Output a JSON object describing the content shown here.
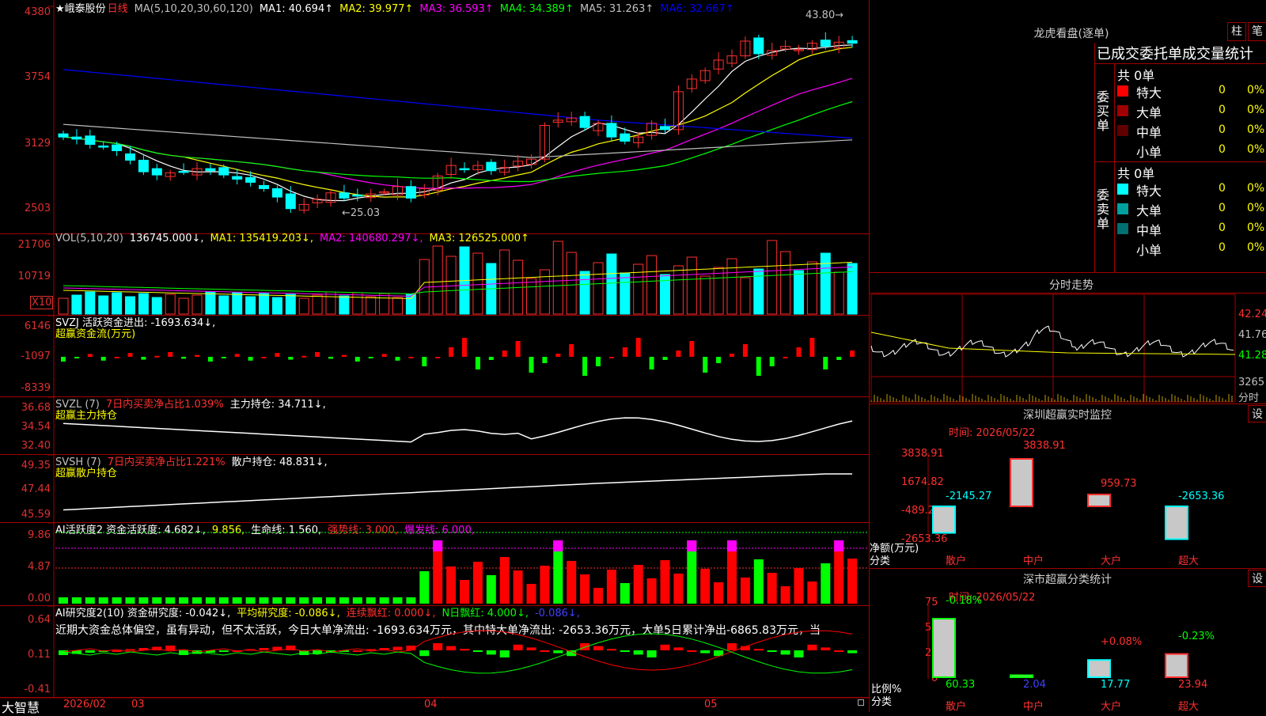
{
  "header": {
    "stock_name": "★峨泰股份",
    "period": "日线",
    "ma_params": "MA(5,10,20,30,60,120)",
    "ma_values": [
      {
        "label": "MA1: 40.694↑",
        "color": "#ffffff"
      },
      {
        "label": "MA2: 39.977↑",
        "color": "#ffff00"
      },
      {
        "label": "MA3: 36.593↑",
        "color": "#ff00ff"
      },
      {
        "label": "MA4: 34.389↑",
        "color": "#00ff00"
      },
      {
        "label": "MA5: 31.263↑",
        "color": "#c0c0c0"
      },
      {
        "label": "MA6: 32.667↑",
        "color": "#0000ff"
      }
    ],
    "high_mark": "43.80→",
    "low_mark": "←25.03"
  },
  "price_axis": [
    "4380",
    "3754",
    "3129",
    "2503"
  ],
  "volume": {
    "header": [
      {
        "label": "VOL(5,10,20)",
        "color": "#c0c0c0"
      },
      {
        "label": "136745.000↓,",
        "color": "#ffffff"
      },
      {
        "label": "MA1: 135419.203↓,",
        "color": "#ffff00"
      },
      {
        "label": "MA2: 140680.297↓,",
        "color": "#ff00ff"
      },
      {
        "label": "MA3: 126525.000↑",
        "color": "#ffff00"
      }
    ],
    "axis": [
      "21706",
      "10719"
    ],
    "unit": "X10"
  },
  "svzj": {
    "header": [
      {
        "label": "SVZJ  活跃资金进出: -1693.634↓,",
        "color": "#ffffff"
      }
    ],
    "subtitle": "超赢资金流(万元)",
    "axis": [
      "6146",
      "-1097",
      "-8339"
    ]
  },
  "svzl": {
    "header": [
      {
        "label": "SVZL (7)",
        "color": "#c0c0c0"
      },
      {
        "label": "7日内买卖净占比1.039%",
        "color": "#ff3030"
      },
      {
        "label": "主力持仓: 34.711↓,",
        "color": "#ffffff"
      }
    ],
    "subtitle": "超赢主力持仓",
    "axis": [
      "36.68",
      "34.54",
      "32.40"
    ]
  },
  "svsh": {
    "header": [
      {
        "label": "SVSH (7)",
        "color": "#c0c0c0"
      },
      {
        "label": "7日内买卖净占比1.221%",
        "color": "#ff3030"
      },
      {
        "label": "散户持仓: 48.831↓,",
        "color": "#ffffff"
      }
    ],
    "subtitle": "超赢散户持仓",
    "axis": [
      "49.35",
      "47.44",
      "45.59"
    ]
  },
  "ai_active": {
    "header": [
      {
        "label": "AI活跃度2 资金活跃度: 4.682↓,",
        "color": "#ffffff"
      },
      {
        "label": "9.856,",
        "color": "#ffff00"
      },
      {
        "label": "生命线: 1.560,",
        "color": "#ffffff"
      },
      {
        "label": "强势线: 3.000,",
        "color": "#ff3030"
      },
      {
        "label": "爆发线: 6.000,",
        "color": "#ff00ff"
      }
    ],
    "axis": [
      "9.86",
      "4.87",
      "0.00"
    ]
  },
  "ai_research": {
    "header": [
      {
        "label": "AI研究度2(10) 资金研究度: -0.042↓,",
        "color": "#ffffff"
      },
      {
        "label": "平均研究度: -0.086↓,",
        "color": "#ffff00"
      },
      {
        "label": "连续飘红: 0.000↓,",
        "color": "#ff3030"
      },
      {
        "label": "N日飘红: 4.000↓,",
        "color": "#00ff00"
      },
      {
        "label": "-0.086↓,",
        "color": "#4040ff"
      }
    ],
    "comment": "近期大资金总体偏空，虽有异动，但不太活跃，今日大单净流出: -1693.634万元，其中特大单净流出: -2653.36万元，大单5日累计净出-6865.83万元，当",
    "axis": [
      "0.64",
      "0.11",
      "-0.41"
    ]
  },
  "footer": {
    "brand": "大智慧",
    "dates": [
      "2026/02",
      "03",
      "04",
      "05"
    ]
  },
  "side": {
    "longhu_title": "龙虎看盘(逐单)",
    "btn_zhu": "柱",
    "btn_bi": "笔",
    "table_title": "已成交委托单成交量统计",
    "buy_label": "委买单",
    "sell_label": "委卖单",
    "buy_total": "共 0单",
    "sell_total": "共 0单",
    "buy_rows": [
      {
        "name": "特大",
        "val": "0",
        "pct": "0%",
        "color": "#ff0000"
      },
      {
        "name": "大单",
        "val": "0",
        "pct": "0%",
        "color": "#a00000"
      },
      {
        "name": "中单",
        "val": "0",
        "pct": "0%",
        "color": "#600000"
      },
      {
        "name": "小单",
        "val": "0",
        "pct": "0%",
        "color": ""
      }
    ],
    "sell_rows": [
      {
        "name": "特大",
        "val": "0",
        "pct": "0%",
        "color": "#00ffff"
      },
      {
        "name": "大单",
        "val": "0",
        "pct": "0%",
        "color": "#00a0a0"
      },
      {
        "name": "中单",
        "val": "0",
        "pct": "0%",
        "color": "#007070"
      },
      {
        "name": "小单",
        "val": "0",
        "pct": "0%",
        "color": ""
      }
    ],
    "intraday_title": "分时走势",
    "intraday_axis": [
      "42.24",
      "41.76",
      "41.28",
      "3265"
    ],
    "intraday_unit": "分时",
    "monitor_title": "深圳超赢实时监控",
    "monitor_set": "设",
    "monitor_time": "时间: 2026/05/22",
    "monitor_axis": [
      "3838.91",
      "1674.82",
      "-489.27",
      "-2653.36"
    ],
    "monitor_unit1": "净额(万元)",
    "monitor_unit2": "分类",
    "monitor_bars": [
      {
        "cat": "散户",
        "val": "-2145.27",
        "color": "#00ffff"
      },
      {
        "cat": "中户",
        "val": "3838.91",
        "color": "#ff3030"
      },
      {
        "cat": "大户",
        "val": "959.73",
        "color": "#ff3030"
      },
      {
        "cat": "超大",
        "val": "-2653.36",
        "color": "#00ffff"
      }
    ],
    "class_title": "深市超赢分类统计",
    "class_set": "设",
    "class_time": "时间: 2026/05/22",
    "class_axis": [
      "75",
      "50",
      "25",
      "0"
    ],
    "class_unit1": "比例%",
    "class_unit2": "分类",
    "class_bars": [
      {
        "cat": "散户",
        "pct": 60.33,
        "top": "-0.18%",
        "top_color": "#00ff00",
        "bot": "60.33",
        "bot_color": "#00ff00"
      },
      {
        "cat": "中户",
        "pct": 2.04,
        "top": "",
        "top_color": "#00ff00",
        "bot": "2.04",
        "bot_color": "#4040ff"
      },
      {
        "cat": "大户",
        "pct": 17.77,
        "top": "+0.08%",
        "top_color": "#ff3030",
        "bot": "17.77",
        "bot_color": "#00ffff"
      },
      {
        "cat": "超大",
        "pct": 23.94,
        "top": "-0.23%",
        "top_color": "#00ff00",
        "bot": "23.94",
        "bot_color": "#ff3030"
      }
    ]
  },
  "chart_data": {
    "type": "candlestick",
    "title": "★峨泰股份 日线",
    "ylim": [
      25.03,
      43.8
    ],
    "x_labels": [
      "2026/02",
      "03",
      "04",
      "05"
    ],
    "series": [
      {
        "name": "MA1",
        "color": "#ffffff"
      },
      {
        "name": "MA2",
        "color": "#ffff00"
      },
      {
        "name": "MA3",
        "color": "#ff00ff"
      },
      {
        "name": "MA4",
        "color": "#00ff00"
      },
      {
        "name": "MA5",
        "color": "#c0c0c0"
      },
      {
        "name": "MA6",
        "color": "#0000ff"
      }
    ],
    "close": [
      32.3,
      32.1,
      31.6,
      31.4,
      31.0,
      30.1,
      29.0,
      28.7,
      28.9,
      29.0,
      29.3,
      29.1,
      28.7,
      28.3,
      28.0,
      27.4,
      26.6,
      25.5,
      25.9,
      26.4,
      27.0,
      26.5,
      26.7,
      26.9,
      27.1,
      27.6,
      26.5,
      27.4,
      28.6,
      29.6,
      29.2,
      29.6,
      29.1,
      29.4,
      30.0,
      30.2,
      33.4,
      33.9,
      34.1,
      33.2,
      33.6,
      32.3,
      31.9,
      32.3,
      33.6,
      33.0,
      36.6,
      37.8,
      38.6,
      39.6,
      40.0,
      41.4,
      40.2,
      40.5,
      40.9,
      40.6,
      41.2,
      40.9,
      41.3,
      41.2
    ]
  }
}
